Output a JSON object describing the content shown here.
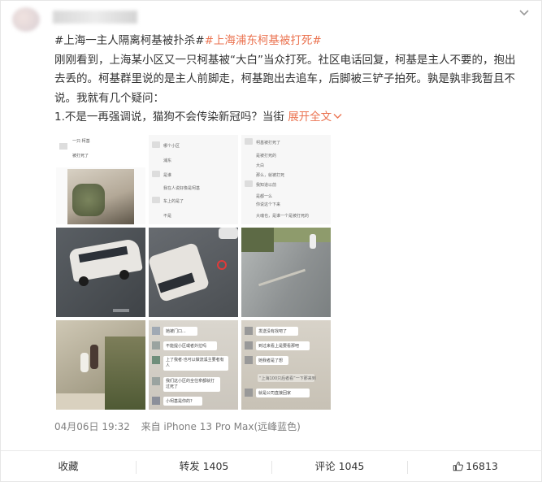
{
  "post": {
    "tag1": "#上海一主人隔离柯基被扑杀#",
    "tag2": "#上海浦东柯基被打死#",
    "line2": "刚刚看到，上海某小区又一只柯基被“大白”当众打死。社区电话回复，柯基是主人不要的，抱出",
    "line3": "去丢的。柯基群里说的是主人前脚走，柯基跑出去追车，后脚被三铲子拍死。孰是孰非我暂且不",
    "line4": "说。我就有几个疑问：",
    "line5": "1.不是一再强调说，猫狗不会传染新冠吗？当街",
    "expand": "展开全文"
  },
  "screenshot_texts": {
    "a1": "一只·柯基",
    "a2": "被打死了",
    "b1": "哪个小区",
    "b2": "浦东",
    "b3": "是谁",
    "b4": "我在人说好像是柯基",
    "b5": "车上的是了",
    "b6": "不是",
    "c1": "柯基被打死了",
    "c2": "是被打死的",
    "c3": "大白",
    "c4": "那么，就被打死",
    "c5": "我知道以前",
    "c6": "是都一么",
    "c7": "你说这个下来",
    "c8": "大魂也，是谁一个是被打死的",
    "d1": "她被门口...",
    "d2": "不能提小区或者外拉吗",
    "d3": "上了我者·也可以做流溪主要者有人",
    "d4": "我们这小区的全住拿都就打过死了",
    "d5": "小柯基是你的?",
    "e1": "发送没有找吧了",
    "e2": "到过来看上是要看那吧",
    "e3": "她我者是了想",
    "e4": "“上海100只后者看”一下那来到",
    "e5": "就是公司直接回家"
  },
  "meta": {
    "date": "04月06日 19:32",
    "source": "来自 iPhone 13 Pro Max(远峰蓝色)"
  },
  "actions": {
    "collect": "收藏",
    "repost": "转发 1405",
    "comment": "评论 1045",
    "like": "16813"
  },
  "colors": {
    "link": "#eb7350",
    "text": "#333333",
    "meta": "#808080"
  }
}
